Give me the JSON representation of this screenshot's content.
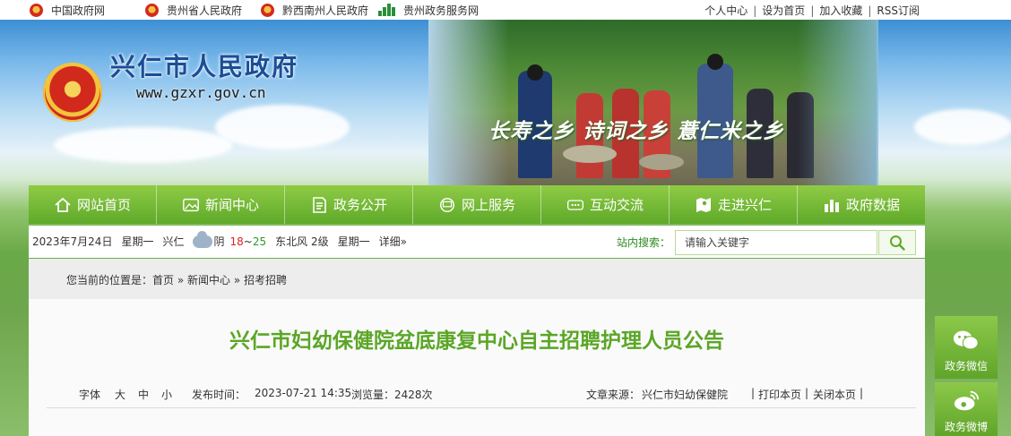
{
  "topbar": {
    "links": [
      {
        "label": "中国政府网",
        "icon": "national-emblem-icon"
      },
      {
        "label": "贵州省人民政府",
        "icon": "national-emblem-icon"
      },
      {
        "label": "黔西南州人民政府",
        "icon": "national-emblem-icon"
      },
      {
        "label": "贵州政务服务网",
        "icon": "gov-service-icon"
      }
    ],
    "right_links": [
      "个人中心",
      "设为首页",
      "加入收藏",
      "RSS订阅"
    ],
    "separator": "|"
  },
  "header": {
    "site_title": "兴仁市人民政府",
    "site_url": "www.gzxr.gov.cn",
    "slogan": "长寿之乡  诗词之乡  薏仁米之乡"
  },
  "nav": {
    "items": [
      {
        "label": "网站首页",
        "icon": "home-icon"
      },
      {
        "label": "新闻中心",
        "icon": "image-icon"
      },
      {
        "label": "政务公开",
        "icon": "document-icon"
      },
      {
        "label": "网上服务",
        "icon": "monitor-icon"
      },
      {
        "label": "互动交流",
        "icon": "chat-icon"
      },
      {
        "label": "走进兴仁",
        "icon": "map-icon"
      },
      {
        "label": "政府数据",
        "icon": "bar-chart-icon"
      }
    ]
  },
  "info": {
    "date": "2023年7月24日",
    "weekday": "星期一",
    "city": "兴仁",
    "weather": "阴",
    "temp_low": "18",
    "temp_sep": "~",
    "temp_high": "25",
    "wind": "东北风 2级",
    "weekday2": "星期一",
    "detail_link": "详细»",
    "search_label": "站内搜索：",
    "search_placeholder": "请输入关键字"
  },
  "breadcrumb": {
    "prefix": "您当前的位置是：",
    "items": [
      "首页",
      "新闻中心",
      "招考招聘"
    ],
    "sep": " » "
  },
  "article": {
    "title": "兴仁市妇幼保健院盆底康复中心自主招聘护理人员公告",
    "font_label": "字体",
    "font_large": "大",
    "font_medium": "中",
    "font_small": "小",
    "publish_label": "发布时间：",
    "publish_time": "2023-07-21 14:35",
    "views_label": "浏览量：",
    "views": "2428次",
    "source_label": "文章来源：",
    "source": "兴仁市妇幼保健院",
    "print_label": "打印本页",
    "close_label": "关闭本页"
  },
  "side": {
    "wechat": "政务微信",
    "weibo": "政务微博"
  },
  "colors": {
    "accent_green": "#5fa92a",
    "title_green": "#5ba626",
    "logo_blue": "#1b4d96"
  }
}
